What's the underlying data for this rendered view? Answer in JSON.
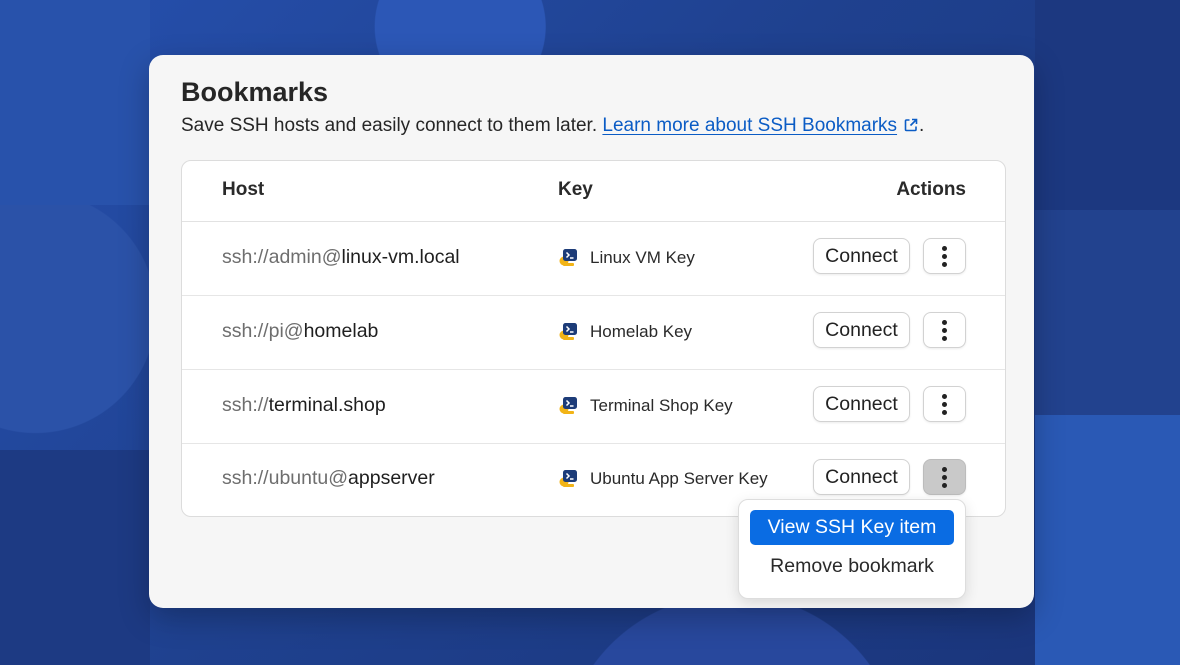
{
  "header": {
    "title": "Bookmarks",
    "subtitle": "Save SSH hosts and easily connect to them later.",
    "link_text": "Learn more about SSH Bookmarks",
    "trailing_period": "."
  },
  "table": {
    "columns": [
      "Host",
      "Key",
      "Actions"
    ],
    "rows": [
      {
        "host_prefix": "ssh://admin@",
        "host_name": "linux-vm.local",
        "key": "Linux VM Key",
        "connect_label": "Connect"
      },
      {
        "host_prefix": "ssh://pi@",
        "host_name": "homelab",
        "key": "Homelab Key",
        "connect_label": "Connect"
      },
      {
        "host_prefix": "ssh://",
        "host_name": "terminal.shop",
        "key": "Terminal Shop Key",
        "connect_label": "Connect"
      },
      {
        "host_prefix": "ssh://ubuntu@",
        "host_name": "appserver",
        "key": "Ubuntu App Server Key",
        "connect_label": "Connect"
      }
    ]
  },
  "context_menu": {
    "items": [
      "View SSH Key item",
      "Remove bookmark"
    ],
    "highlighted_index": 0
  },
  "icons": {
    "link": "external-link-icon",
    "key": "ssh-key-icon",
    "more": "more-vertical-icon"
  },
  "colors": {
    "link": "#0b5cc5",
    "menu_highlight": "#0a6ce3",
    "background": "#1e3f8f"
  }
}
